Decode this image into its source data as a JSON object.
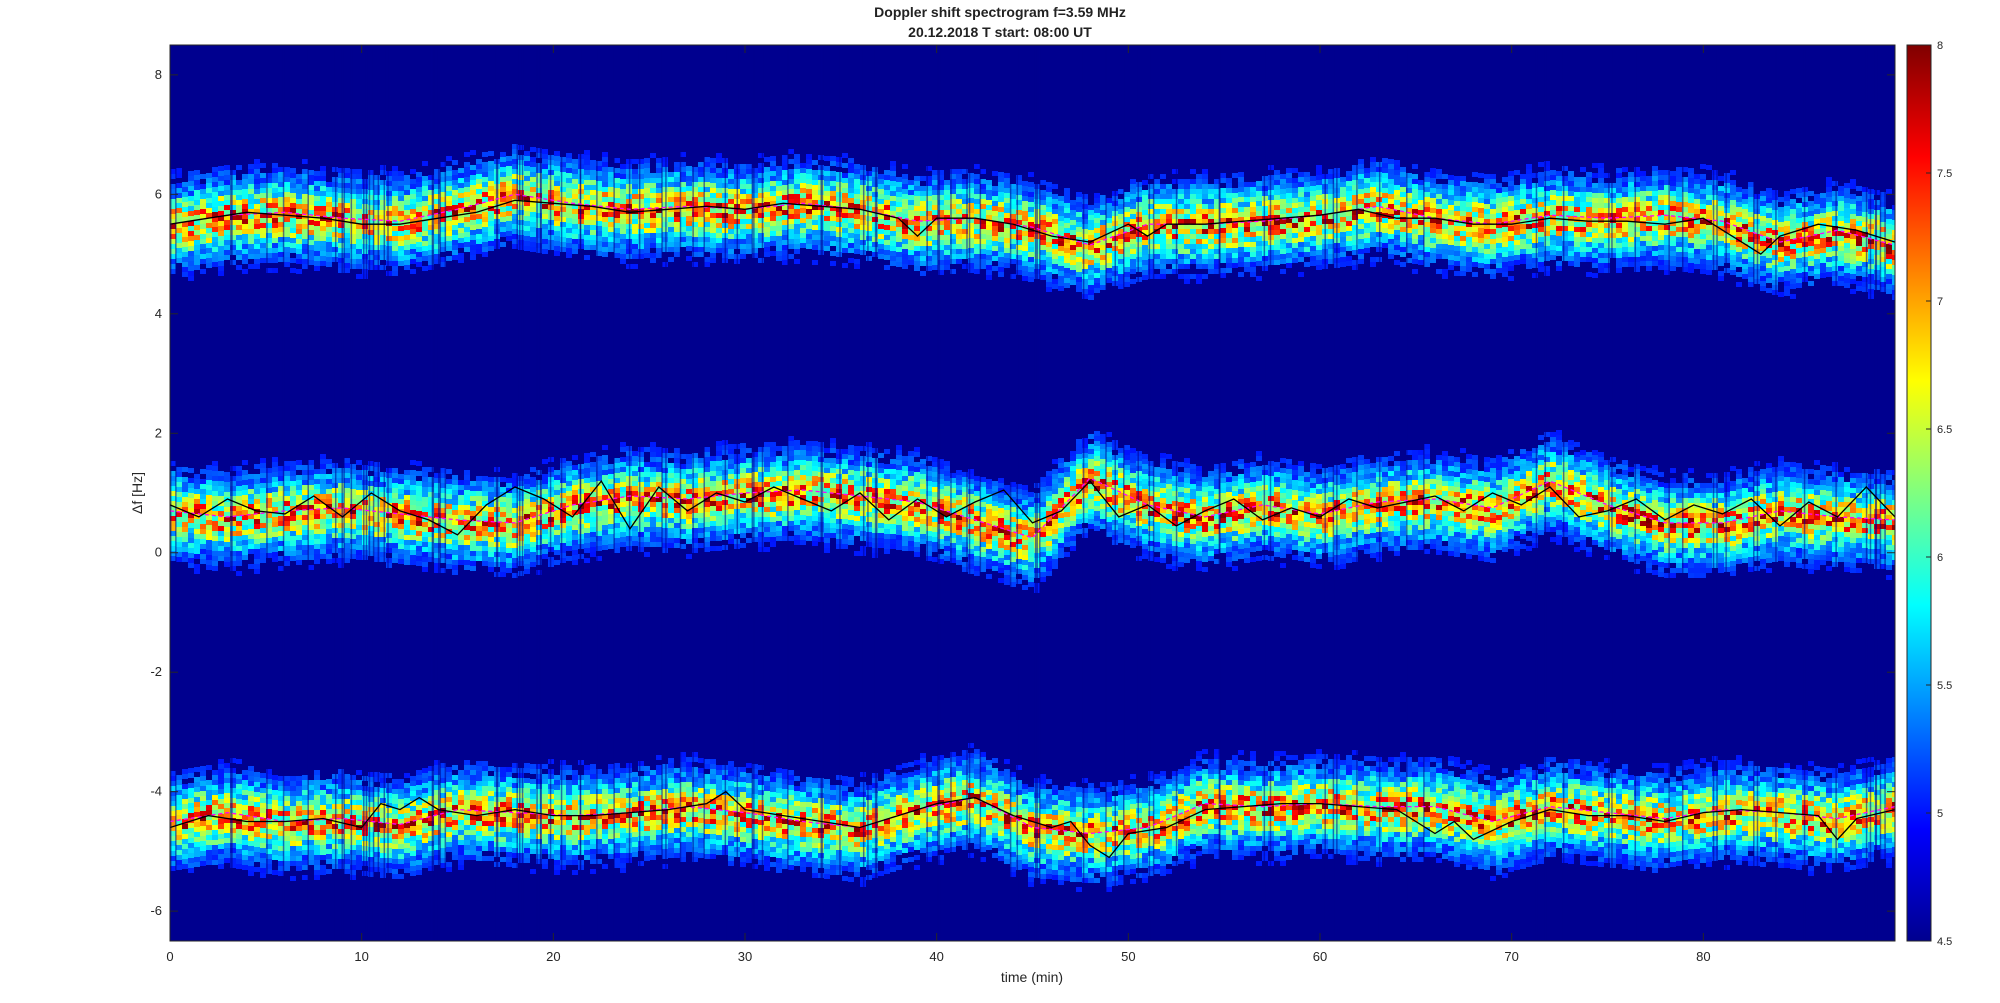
{
  "chart_data": {
    "type": "heatmap",
    "title": "Doppler shift spectrogram f=3.59 MHz",
    "subtitle": "20.12.2018   T start: 08:00 UT",
    "xlabel": "time (min)",
    "ylabel": "Δf [Hz]",
    "xlim": [
      0,
      90
    ],
    "ylim": [
      -6.5,
      8.5
    ],
    "x_ticks": [
      "0",
      "10",
      "20",
      "30",
      "40",
      "50",
      "60",
      "70",
      "80"
    ],
    "y_ticks": [
      "-6",
      "-4",
      "-2",
      "0",
      "2",
      "4",
      "6",
      "8"
    ],
    "colorbar": {
      "colormap": "jet",
      "range": [
        4.5,
        8
      ],
      "ticks": [
        "4.5",
        "5",
        "5.5",
        "6",
        "6.5",
        "7",
        "7.5",
        "8"
      ]
    },
    "background_level": 4.6,
    "grid": false,
    "series": [
      {
        "color": "#ff00ff",
        "style": "dashed",
        "x": [
          0,
          3,
          6,
          9,
          12,
          15,
          18,
          21,
          24,
          27,
          30,
          33,
          36,
          39,
          42,
          45,
          48,
          51,
          54,
          57,
          60,
          63,
          66,
          69,
          72,
          75,
          78,
          81,
          84,
          87,
          90
        ],
        "y": [
          5.5,
          5.65,
          5.7,
          5.6,
          5.55,
          5.75,
          6.0,
          5.85,
          5.75,
          5.8,
          5.75,
          5.85,
          5.75,
          5.55,
          5.6,
          5.45,
          5.15,
          5.5,
          5.5,
          5.55,
          5.65,
          5.8,
          5.6,
          5.5,
          5.65,
          5.6,
          5.65,
          5.55,
          5.2,
          5.4,
          5.15
        ]
      },
      {
        "color": "#ff00ff",
        "style": "dashed",
        "x": [
          0,
          3,
          6,
          9,
          12,
          15,
          18,
          21,
          24,
          27,
          30,
          33,
          36,
          39,
          42,
          45,
          48,
          51,
          54,
          57,
          60,
          63,
          66,
          69,
          72,
          75,
          78,
          81,
          84,
          87,
          90
        ],
        "y": [
          0.7,
          0.6,
          0.7,
          0.75,
          0.65,
          0.55,
          0.5,
          0.8,
          0.95,
          0.9,
          1.0,
          1.05,
          0.95,
          0.85,
          0.55,
          0.25,
          1.25,
          0.8,
          0.6,
          0.8,
          0.65,
          0.85,
          0.9,
          0.75,
          1.2,
          0.8,
          0.5,
          0.5,
          0.7,
          0.6,
          0.55
        ]
      },
      {
        "color": "#ff00ff",
        "style": "dashed",
        "x": [
          0,
          3,
          6,
          9,
          12,
          15,
          18,
          21,
          24,
          27,
          30,
          33,
          36,
          39,
          42,
          45,
          48,
          51,
          54,
          57,
          60,
          63,
          66,
          69,
          72,
          75,
          78,
          81,
          84,
          87,
          90
        ],
        "y": [
          -4.5,
          -4.35,
          -4.5,
          -4.45,
          -4.55,
          -4.3,
          -4.35,
          -4.4,
          -4.35,
          -4.25,
          -4.35,
          -4.5,
          -4.6,
          -4.3,
          -4.1,
          -4.6,
          -4.7,
          -4.6,
          -4.2,
          -4.25,
          -4.2,
          -4.25,
          -4.25,
          -4.5,
          -4.25,
          -4.35,
          -4.45,
          -4.3,
          -4.35,
          -4.45,
          -4.25
        ]
      },
      {
        "color": "#000000",
        "style": "solid",
        "x": [
          0,
          1.5,
          3,
          4.5,
          6,
          7.5,
          9,
          10.5,
          12,
          13.5,
          15,
          16.5,
          18,
          19.5,
          21,
          22.5,
          24,
          25.5,
          27,
          28.5,
          30,
          31.5,
          33,
          34.5,
          36,
          37.5,
          39,
          40.5,
          42,
          43.5,
          45,
          46.5,
          48,
          49.5,
          51,
          52.5,
          54,
          55.5,
          57,
          58.5,
          60,
          61.5,
          63,
          64.5,
          66,
          67.5,
          69,
          70.5,
          72,
          73.5,
          75,
          76.5,
          78,
          79.5,
          81,
          82.5,
          84,
          85.5,
          87,
          88.5,
          90
        ],
        "y": [
          0.8,
          0.6,
          0.9,
          0.7,
          0.65,
          0.95,
          0.6,
          1.0,
          0.7,
          0.55,
          0.3,
          0.8,
          1.1,
          0.9,
          0.6,
          1.2,
          0.4,
          1.1,
          0.7,
          1.0,
          0.85,
          1.1,
          0.9,
          0.7,
          1.0,
          0.55,
          0.9,
          0.6,
          0.85,
          1.05,
          0.5,
          0.7,
          1.2,
          0.6,
          0.8,
          0.45,
          0.7,
          0.9,
          0.55,
          0.75,
          0.6,
          0.9,
          0.75,
          0.85,
          0.95,
          0.7,
          1.0,
          0.8,
          1.1,
          0.6,
          0.7,
          0.9,
          0.55,
          0.8,
          0.65,
          0.9,
          0.45,
          0.85,
          0.6,
          1.1,
          0.6
        ]
      },
      {
        "color": "#000000",
        "style": "solid",
        "x": [
          0,
          2,
          4,
          6,
          8,
          10,
          11,
          12,
          13,
          14,
          16,
          18,
          20,
          22,
          24,
          26,
          28,
          29,
          30,
          32,
          34,
          36,
          38,
          40,
          42,
          44,
          46,
          47,
          48,
          49,
          50,
          52,
          54,
          56,
          58,
          60,
          62,
          64,
          66,
          67,
          68,
          70,
          72,
          74,
          76,
          78,
          80,
          82,
          84,
          86,
          87,
          88,
          90
        ],
        "y": [
          -4.6,
          -4.4,
          -4.5,
          -4.5,
          -4.45,
          -4.6,
          -4.2,
          -4.3,
          -4.1,
          -4.3,
          -4.4,
          -4.3,
          -4.4,
          -4.4,
          -4.35,
          -4.3,
          -4.2,
          -4.0,
          -4.3,
          -4.4,
          -4.5,
          -4.6,
          -4.4,
          -4.2,
          -4.1,
          -4.4,
          -4.6,
          -4.5,
          -4.9,
          -5.1,
          -4.7,
          -4.6,
          -4.3,
          -4.25,
          -4.2,
          -4.2,
          -4.25,
          -4.3,
          -4.7,
          -4.5,
          -4.8,
          -4.5,
          -4.3,
          -4.4,
          -4.4,
          -4.5,
          -4.35,
          -4.3,
          -4.35,
          -4.4,
          -4.8,
          -4.45,
          -4.3
        ]
      },
      {
        "color": "#000000",
        "style": "solid",
        "x": [
          0,
          2,
          4,
          6,
          8,
          10,
          12,
          14,
          16,
          18,
          20,
          22,
          24,
          26,
          28,
          30,
          32,
          34,
          36,
          38,
          39,
          40,
          42,
          44,
          46,
          48,
          50,
          51,
          52,
          54,
          56,
          58,
          60,
          62,
          64,
          66,
          68,
          70,
          72,
          74,
          76,
          78,
          80,
          82,
          83,
          84,
          86,
          88,
          90
        ],
        "y": [
          5.5,
          5.6,
          5.7,
          5.65,
          5.6,
          5.5,
          5.5,
          5.6,
          5.7,
          5.9,
          5.85,
          5.8,
          5.7,
          5.75,
          5.8,
          5.75,
          5.85,
          5.8,
          5.75,
          5.6,
          5.3,
          5.6,
          5.6,
          5.5,
          5.3,
          5.2,
          5.5,
          5.3,
          5.5,
          5.5,
          5.55,
          5.6,
          5.65,
          5.75,
          5.6,
          5.6,
          5.5,
          5.5,
          5.6,
          5.55,
          5.55,
          5.5,
          5.6,
          5.2,
          5.0,
          5.3,
          5.5,
          5.4,
          5.2
        ]
      }
    ]
  }
}
